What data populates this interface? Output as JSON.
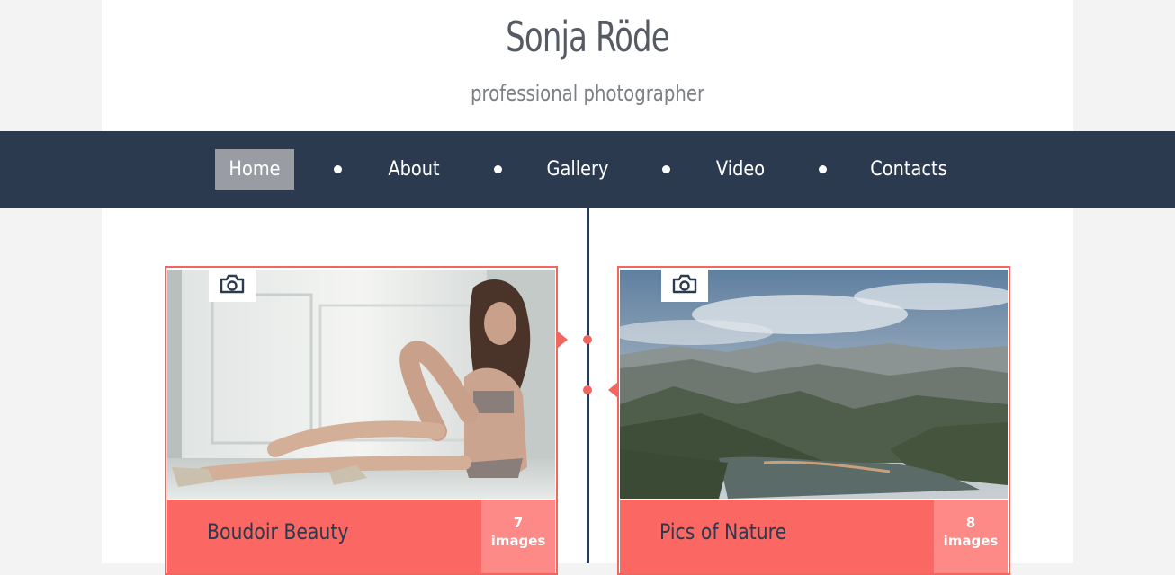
{
  "header": {
    "title": "Sonja Röde",
    "subtitle": "professional photographer"
  },
  "nav": {
    "items": [
      {
        "label": "Home",
        "active": true
      },
      {
        "label": "About",
        "active": false
      },
      {
        "label": "Gallery",
        "active": false
      },
      {
        "label": "Video",
        "active": false
      },
      {
        "label": "Contacts",
        "active": false
      }
    ]
  },
  "cards": [
    {
      "title": "Boudoir Beauty",
      "count": "7",
      "count_label": "images",
      "icon": "camera-icon"
    },
    {
      "title": "Pics of Nature",
      "count": "8",
      "count_label": "images",
      "icon": "camera-icon"
    }
  ],
  "colors": {
    "nav_bg": "#2b3a4f",
    "accent": "#f26660",
    "active_nav": "#999ca2"
  }
}
